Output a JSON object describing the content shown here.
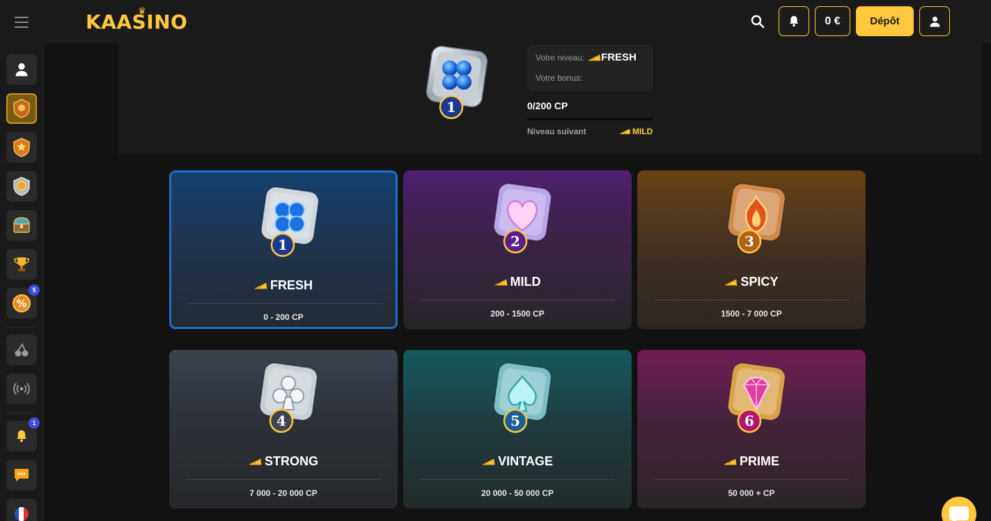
{
  "header": {
    "logo_text": "KAASINO",
    "balance": "0 €",
    "deposit_label": "Dépôt"
  },
  "sidebar": {
    "badges": {
      "promotions": "5",
      "notifications": "1"
    }
  },
  "level_status": {
    "level_label": "Votre niveau:",
    "level_name": "FRESH",
    "bonus_label": "Votre bonus:",
    "progress_text": "0/200 CP",
    "progress_fraction": 0,
    "next_label": "Niveau suivant",
    "next_level_name": "MILD"
  },
  "levels": [
    {
      "number": "1",
      "name": "FRESH",
      "range": "0 - 200 CP",
      "selected": true
    },
    {
      "number": "2",
      "name": "MILD",
      "range": "200 - 1500 CP",
      "selected": false
    },
    {
      "number": "3",
      "name": "SPICY",
      "range": "1500 - 7 000 CP",
      "selected": false
    },
    {
      "number": "4",
      "name": "STRONG",
      "range": "7 000 - 20 000 CP",
      "selected": false
    },
    {
      "number": "5",
      "name": "VINTAGE",
      "range": "20 000 - 50 000 CP",
      "selected": false
    },
    {
      "number": "6",
      "name": "PRIME",
      "range": "50 000 + CP",
      "selected": false
    }
  ],
  "colors": {
    "accent": "#ffc83d",
    "selected_border": "#1f6fc9",
    "background": "#121212"
  }
}
